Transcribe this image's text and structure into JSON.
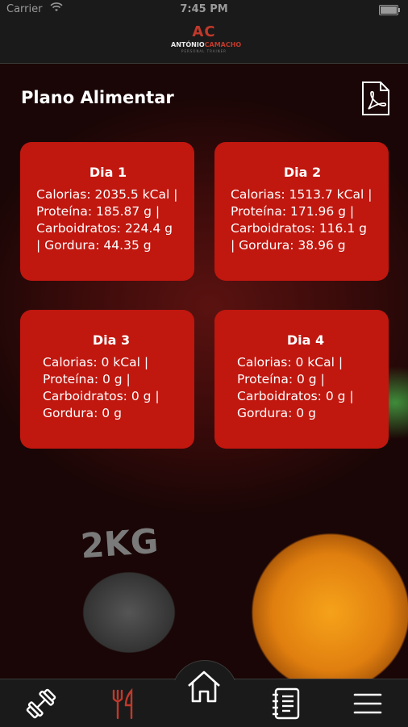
{
  "status": {
    "carrier": "Carrier",
    "time": "7:45 PM"
  },
  "header": {
    "logo_mark": "AC",
    "logo_name_a": "ANTÓNIO",
    "logo_name_b": "CAMACHO",
    "logo_sub": "PERSONAL TRAINER"
  },
  "page": {
    "title": "Plano Alimentar",
    "pdf_icon": "pdf-file-icon"
  },
  "days": [
    {
      "label": "Dia 1",
      "stats": "Calorias: 2035.5 kCal | Proteína: 185.87 g | Carboidratos: 224.4 g | Gordura: 44.35 g"
    },
    {
      "label": "Dia 2",
      "stats": "Calorias: 1513.7 kCal | Proteína: 171.96 g | Carboidratos: 116.1 g | Gordura: 38.96 g"
    },
    {
      "label": "Dia 3",
      "stats": "Calorias: 0 kCal | Proteína: 0 g | Carboidratos: 0 g | Gordura: 0 g"
    },
    {
      "label": "Dia 4",
      "stats": "Calorias: 0 kCal | Proteína: 0 g | Carboidratos: 0 g | Gordura: 0 g"
    }
  ],
  "background": {
    "weight_text": "2KG"
  },
  "tabs": [
    {
      "name": "workout",
      "icon": "dumbbell-icon",
      "active": false
    },
    {
      "name": "nutrition",
      "icon": "fork-knife-icon",
      "active": true
    },
    {
      "name": "home",
      "icon": "home-icon",
      "active": false
    },
    {
      "name": "notes",
      "icon": "notebook-icon",
      "active": false
    },
    {
      "name": "menu",
      "icon": "hamburger-menu-icon",
      "active": false
    }
  ],
  "colors": {
    "card": "#c0170f",
    "accent": "#c0392b",
    "bar": "#1a1a1a",
    "active_tab": "#c0392b",
    "inactive_tab": "#ffffff"
  }
}
